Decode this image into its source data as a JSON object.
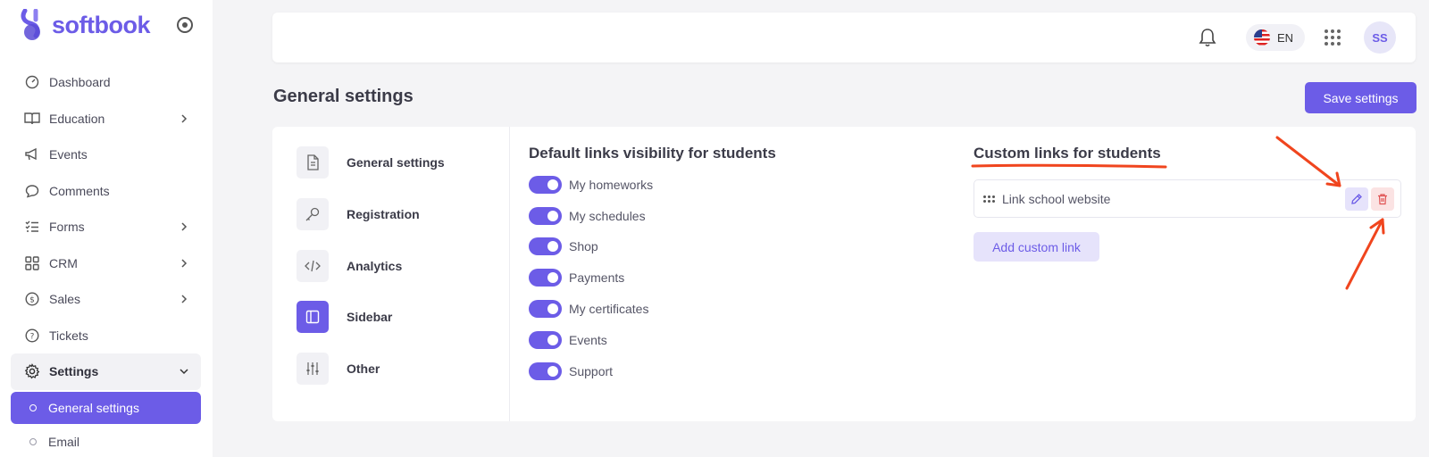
{
  "brand": {
    "name": "softbook"
  },
  "sidebar": {
    "items": [
      {
        "label": "Dashboard",
        "icon": "dashboard-icon",
        "has_children": false
      },
      {
        "label": "Education",
        "icon": "book-icon",
        "has_children": true
      },
      {
        "label": "Events",
        "icon": "megaphone-icon",
        "has_children": false
      },
      {
        "label": "Comments",
        "icon": "comment-icon",
        "has_children": false
      },
      {
        "label": "Forms",
        "icon": "checklist-icon",
        "has_children": true
      },
      {
        "label": "CRM",
        "icon": "grid-icon",
        "has_children": true
      },
      {
        "label": "Sales",
        "icon": "dollar-icon",
        "has_children": true
      },
      {
        "label": "Tickets",
        "icon": "help-icon",
        "has_children": false
      },
      {
        "label": "Settings",
        "icon": "gear-icon",
        "has_children": true,
        "expanded": true
      }
    ],
    "sub_items": [
      {
        "label": "General settings",
        "active": true
      },
      {
        "label": "Email",
        "active": false
      }
    ]
  },
  "topbar": {
    "language": "EN",
    "avatar_initials": "SS"
  },
  "page": {
    "title": "General settings",
    "save_label": "Save settings"
  },
  "settings_nav": [
    {
      "label": "General settings",
      "icon": "document-icon",
      "active": false
    },
    {
      "label": "Registration",
      "icon": "key-icon",
      "active": false
    },
    {
      "label": "Analytics",
      "icon": "code-icon",
      "active": false
    },
    {
      "label": "Sidebar",
      "icon": "sidebar-icon",
      "active": true
    },
    {
      "label": "Other",
      "icon": "sliders-icon",
      "active": false
    }
  ],
  "default_links": {
    "title": "Default links visibility for students",
    "items": [
      {
        "label": "My homeworks",
        "enabled": true
      },
      {
        "label": "My schedules",
        "enabled": true
      },
      {
        "label": "Shop",
        "enabled": true
      },
      {
        "label": "Payments",
        "enabled": true
      },
      {
        "label": "My certificates",
        "enabled": true
      },
      {
        "label": "Events",
        "enabled": true
      },
      {
        "label": "Support",
        "enabled": true
      }
    ]
  },
  "custom_links": {
    "title": "Custom links for students",
    "items": [
      {
        "label": "Link school website"
      }
    ],
    "add_label": "Add custom link"
  },
  "colors": {
    "accent": "#6c5ce7",
    "annotation": "#f0451e",
    "danger": "#e05454"
  }
}
